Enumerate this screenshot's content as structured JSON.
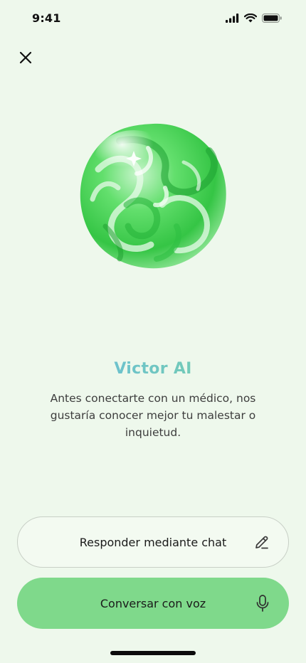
{
  "status_bar": {
    "time": "9:41"
  },
  "icons": {
    "close": "close-icon",
    "cellular": "cellular-signal-icon",
    "wifi": "wifi-icon",
    "battery": "battery-icon",
    "edit": "pencil-icon",
    "microphone": "microphone-icon"
  },
  "assistant": {
    "name": "Victor AI",
    "description": "Antes conectarte con un médico, nos gustaría conocer mejor tu malestar o inquietud."
  },
  "actions": {
    "chat_label": "Responder mediante chat",
    "voice_label": "Conversar con voz"
  },
  "colors": {
    "background": "#eef8ec",
    "title_gradient_start": "#65b6ea",
    "title_gradient_end": "#7ad69b",
    "voice_button": "#7fd98b",
    "orb_green": "#3fd04f"
  }
}
